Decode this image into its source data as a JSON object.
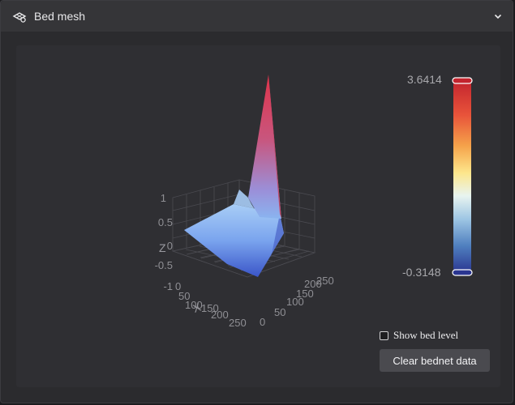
{
  "header": {
    "title": "Bed mesh",
    "icon": "bed-mesh-icon",
    "collapse_icon": "chevron-down-icon"
  },
  "plot": {
    "type": "surface3d",
    "z_ticks": [
      "1",
      "0.5",
      "0",
      "-0.5",
      "-1"
    ],
    "z_label": "Z",
    "x_ticks": [
      "0",
      "50",
      "100",
      "150",
      "200",
      "250"
    ],
    "x_label": "X",
    "y_ticks": [
      "0",
      "50",
      "100",
      "150",
      "200",
      "250"
    ],
    "colors": {
      "peak": "#e0334a",
      "high": "#c06090",
      "mid": "#8ab4f0",
      "low": "#3a55c8"
    }
  },
  "color_scale": {
    "max_label": "3.6414",
    "min_label": "-0.3148",
    "max": 3.6414,
    "min": -0.3148,
    "gradient": [
      "#c3242e",
      "#e8533a",
      "#f5a24a",
      "#fde68b",
      "#e8f4f0",
      "#9ec6e4",
      "#4f7fbf",
      "#2a3590"
    ]
  },
  "show_bed_level": {
    "label": "Show bed level",
    "checked": false
  },
  "clear_button": {
    "label": "Clear bednet data"
  }
}
